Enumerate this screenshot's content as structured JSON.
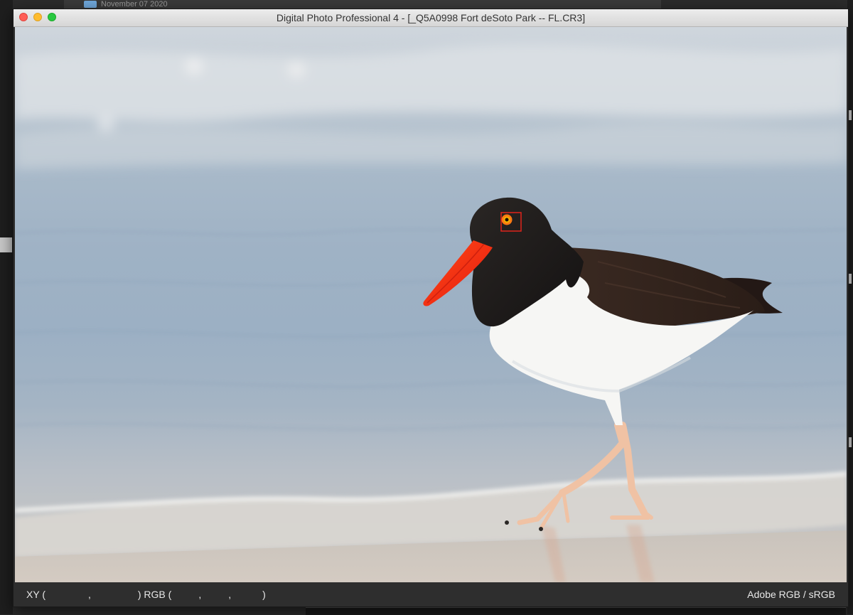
{
  "background": {
    "folder_label": "November 07 2020"
  },
  "window": {
    "title": "Digital Photo Professional 4 - [_Q5A0998 Fort deSoto Park -- FL.CR3]"
  },
  "viewer": {
    "subject": "American oystercatcher walking in shallow surf",
    "af_point_color": "#e0241b"
  },
  "statusbar": {
    "xy_label": "XY (",
    "xy_sep": ",",
    "rgb_label": ") RGB (",
    "rgb_sep1": ",",
    "rgb_sep2": ",",
    "rgb_close": ")",
    "color_space": "Adobe RGB / sRGB"
  }
}
